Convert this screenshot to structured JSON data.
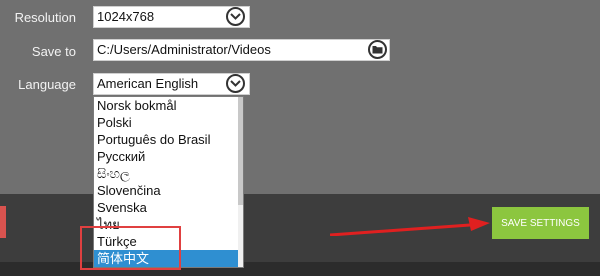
{
  "form": {
    "resolution": {
      "label": "Resolution",
      "value": "1024x768",
      "button_icon": "chevron-down-icon"
    },
    "save_to": {
      "label": "Save to",
      "value": "C:/Users/Administrator/Videos",
      "button_icon": "folder-icon"
    },
    "language": {
      "label": "Language",
      "value": "American English",
      "button_icon": "chevron-down-icon",
      "options": [
        "Norsk bokmål",
        "Polski",
        "Português do Brasil",
        "Русский",
        "සිංහල",
        "Slovenčina",
        "Svenska",
        "ไทย",
        "Türkçe",
        "简体中文"
      ],
      "selected": "简体中文"
    }
  },
  "save_button": {
    "label": "SAVE SETTINGS",
    "color": "#8cc63f"
  },
  "annotations": {
    "highlight_color": "#e04040",
    "arrow_color": "#e02020"
  },
  "colors": {
    "selection": "#2f8fd1",
    "panel": "#707070",
    "footer": "#3d3d3d"
  }
}
